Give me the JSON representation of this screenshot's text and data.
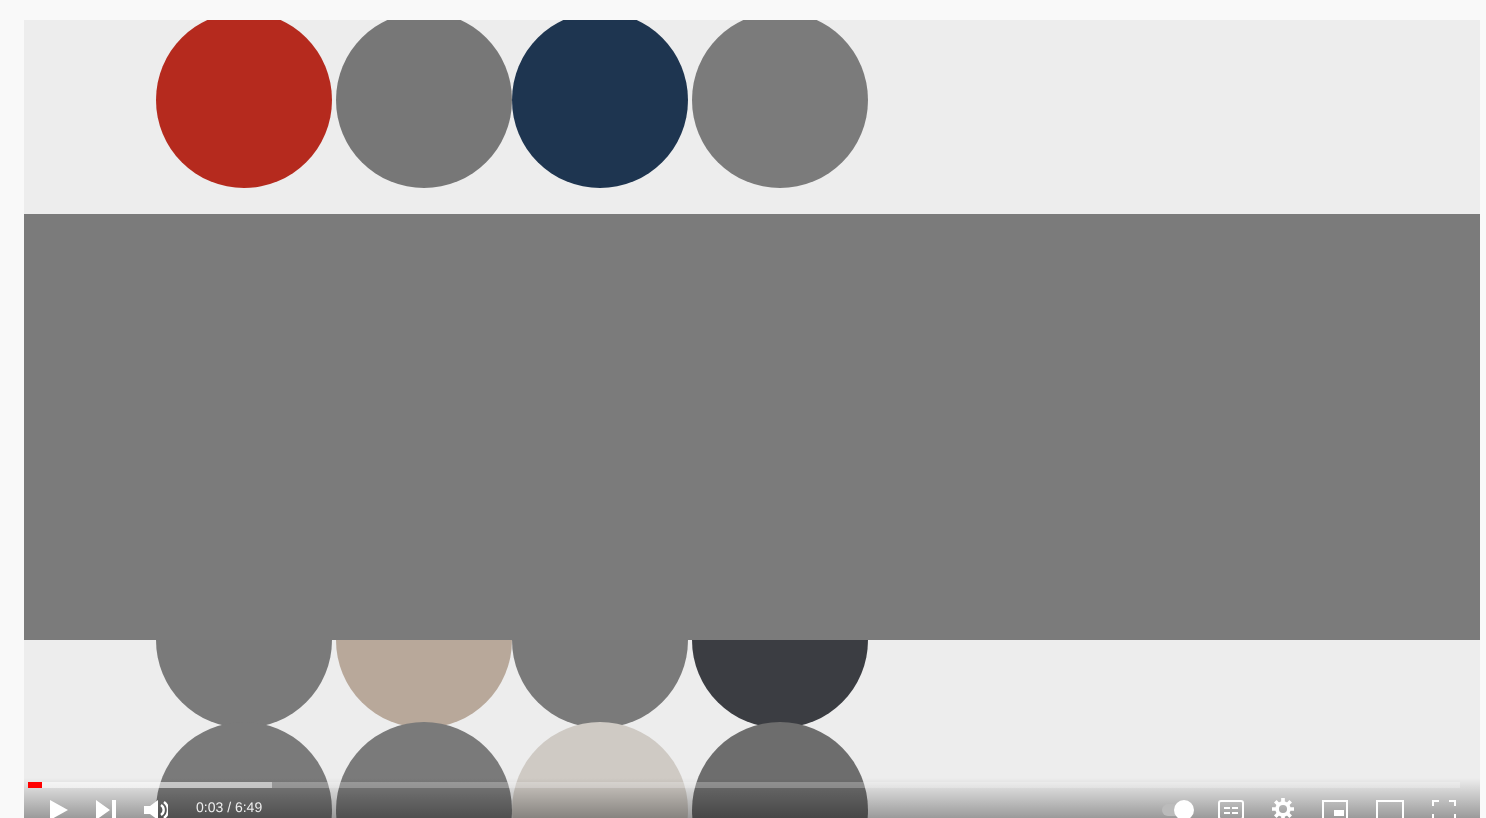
{
  "player": {
    "progress": {
      "level": 0.01
    },
    "left_controls": [
      {
        "kind": "play"
      },
      {
        "kind": "next"
      },
      {
        "kind": "volume"
      }
    ],
    "time": "0:03 / 6:49",
    "autoplay": {
      "on": true
    },
    "right_controls": [
      {
        "kind": "captions"
      },
      {
        "kind": "settings"
      },
      {
        "kind": "miniplayer"
      },
      {
        "kind": "theater"
      },
      {
        "kind": "fullscreen"
      }
    ]
  }
}
